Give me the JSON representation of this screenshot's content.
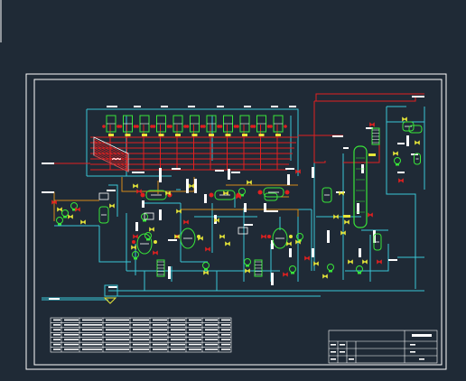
{
  "view": {
    "background": "#1f2a36",
    "line_colors": {
      "border": "#ffffff",
      "process_cyan": "#39c6d6",
      "steam_red": "#e02020",
      "vapor_orange": "#d68a1a",
      "equipment_green": "#39e639",
      "valve_yellow": "#e6e639",
      "label_white": "#ffffff"
    }
  },
  "drawing": {
    "outer_frame": true,
    "inner_frame": true,
    "equipment": [
      {
        "kind": "rotary-dryer-bank",
        "count": 11
      },
      {
        "kind": "grate-bed"
      },
      {
        "kind": "horizontal-exchanger",
        "count": 3
      },
      {
        "kind": "reaction-kettle",
        "count": 3
      },
      {
        "kind": "condenser",
        "count": 4
      },
      {
        "kind": "storage-tank",
        "count": 2
      },
      {
        "kind": "distillation-column",
        "count": 1
      },
      {
        "kind": "reflux-drum",
        "count": 2
      }
    ]
  },
  "material_table": {
    "rows": 7,
    "columns": 10
  },
  "title_block": {
    "rows": 4
  }
}
